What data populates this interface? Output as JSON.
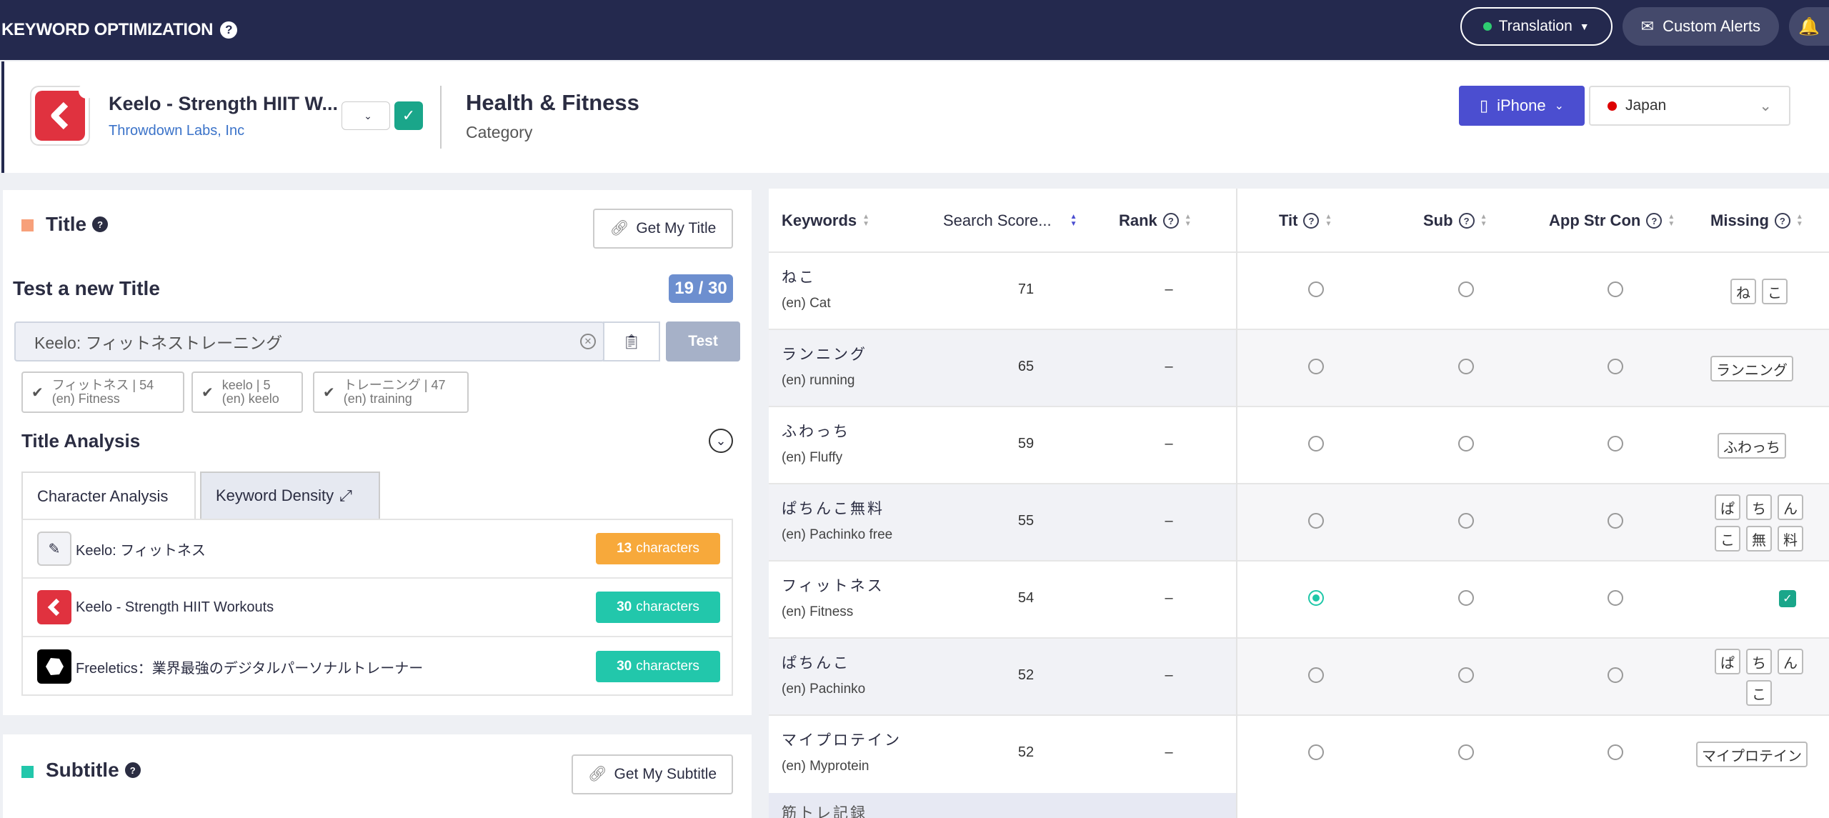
{
  "topbar": {
    "title": "KEYWORD OPTIMIZATION",
    "translation_label": "Translation",
    "custom_alerts_label": "Custom Alerts"
  },
  "app": {
    "name": "Keelo - Strength HIIT W...",
    "developer": "Throwdown Labs, Inc",
    "category": "Health & Fitness",
    "category_label": "Category",
    "device": "iPhone",
    "country": "Japan"
  },
  "title_section": {
    "heading": "Title",
    "get_button": "Get My Title",
    "test_heading": "Test a new Title",
    "char_count": "19 / 30",
    "input_value": "Keelo: フィットネストレーニング",
    "test_button": "Test",
    "chips": [
      {
        "line1": "フィットネス | 54",
        "line2": "(en) Fitness"
      },
      {
        "line1": "keelo | 5",
        "line2": "(en) keelo"
      },
      {
        "line1": "トレーニング | 47",
        "line2": "(en) training"
      }
    ],
    "analysis_heading": "Title Analysis",
    "tabs": [
      "Character Analysis",
      "Keyword Density"
    ],
    "rows": [
      {
        "text": "Keelo: フィットネス",
        "count": "13",
        "unit": "characters",
        "color": "#f7a93b"
      },
      {
        "text": "Keelo - Strength HIIT Workouts",
        "count": "30",
        "unit": "characters",
        "color": "#22c7ab"
      },
      {
        "text": "Freeletics：業界最強のデジタルパーソナルトレーナー",
        "count": "30",
        "unit": "characters",
        "color": "#22c7ab"
      }
    ]
  },
  "subtitle_section": {
    "heading": "Subtitle",
    "get_button": "Get My Subtitle"
  },
  "table": {
    "headers": [
      "Keywords",
      "Search Score...",
      "Rank",
      "Tit",
      "Sub",
      "App Str Con",
      "Missing"
    ],
    "rows": [
      {
        "kw": "ねこ",
        "en": "(en) Cat",
        "score": "71",
        "rank": "–",
        "tit": false,
        "missing": [
          "ね",
          "こ"
        ]
      },
      {
        "kw": "ランニング",
        "en": "(en) running",
        "score": "65",
        "rank": "–",
        "tit": false,
        "missing": [
          "ランニング"
        ]
      },
      {
        "kw": "ふわっち",
        "en": "(en) Fluffy",
        "score": "59",
        "rank": "–",
        "tit": false,
        "missing": [
          "ふわっち"
        ]
      },
      {
        "kw": "ぱちんこ無料",
        "en": "(en) Pachinko free",
        "score": "55",
        "rank": "–",
        "tit": false,
        "missing": [
          "ぱ",
          "ち",
          "ん",
          "こ",
          "無",
          "料"
        ]
      },
      {
        "kw": "フィットネス",
        "en": "(en) Fitness",
        "score": "54",
        "rank": "–",
        "tit": true,
        "missing": []
      },
      {
        "kw": "ぱちんこ",
        "en": "(en) Pachinko",
        "score": "52",
        "rank": "–",
        "tit": false,
        "missing": [
          "ぱ",
          "ち",
          "ん",
          "こ"
        ]
      },
      {
        "kw": "マイプロテイン",
        "en": "(en) Myprotein",
        "score": "52",
        "rank": "–",
        "tit": false,
        "missing": [
          "マイプロテイン"
        ]
      }
    ],
    "partial_row": "筋トレ記録"
  },
  "colors": {
    "navy": "#24294e",
    "accent": "#4b4ed0",
    "green": "#1aa68a",
    "orange": "#f7a93b",
    "teal": "#22c7ab"
  }
}
